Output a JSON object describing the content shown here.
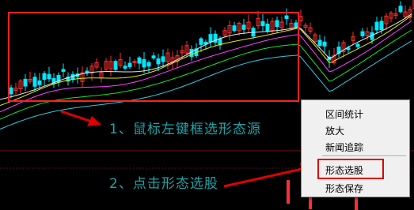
{
  "annotations": {
    "step1": "1、鼠标左键框选形态源",
    "step2": "2、点击形态选股"
  },
  "context_menu": {
    "items": [
      {
        "label": "区间统计"
      },
      {
        "label": "放大"
      },
      {
        "label": "新闻追踪"
      },
      {
        "label": "形态选股",
        "highlighted": true
      },
      {
        "label": "形态保存"
      }
    ]
  },
  "colors": {
    "background": "#000000",
    "up_candle": "#ff3030",
    "down_candle": "#00e8ff",
    "selection_box": "#ff2020",
    "annotation_text": "#1fa3a8",
    "arrow": "#e00000",
    "menu_bg": "#f0f0f0",
    "ma_white": "#e8e8e8",
    "ma_yellow": "#e8e800",
    "ma_magenta": "#ff40ff",
    "ma_green": "#20e020",
    "ma_cyan": "#30c8e0"
  }
}
